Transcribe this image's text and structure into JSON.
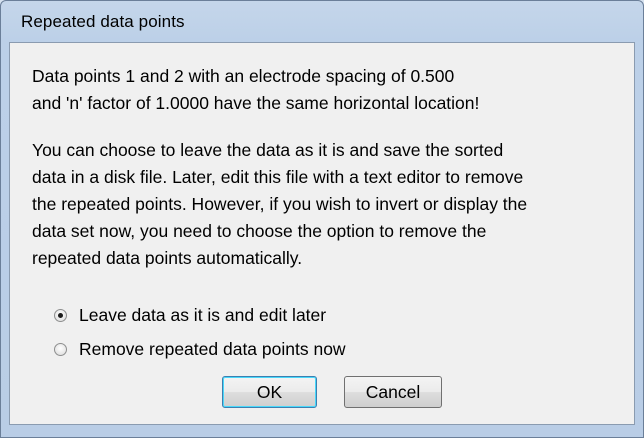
{
  "window": {
    "title": "Repeated data points"
  },
  "message": {
    "line1": "Data points 1 and 2 with an electrode spacing of 0.500\nand 'n' factor of 1.0000 have the same horizontal location!",
    "line2": "You can choose to leave the data as it is and save the sorted\ndata in a disk file. Later, edit this file with a text editor to remove\nthe repeated points. However, if you wish to invert or display the\ndata set now, you need to choose the option to remove the\nrepeated data points automatically."
  },
  "options": [
    {
      "label": "Leave data as it is and edit later",
      "selected": true
    },
    {
      "label": "Remove repeated data points now",
      "selected": false
    }
  ],
  "buttons": {
    "ok_label": "OK",
    "cancel_label": "Cancel"
  }
}
